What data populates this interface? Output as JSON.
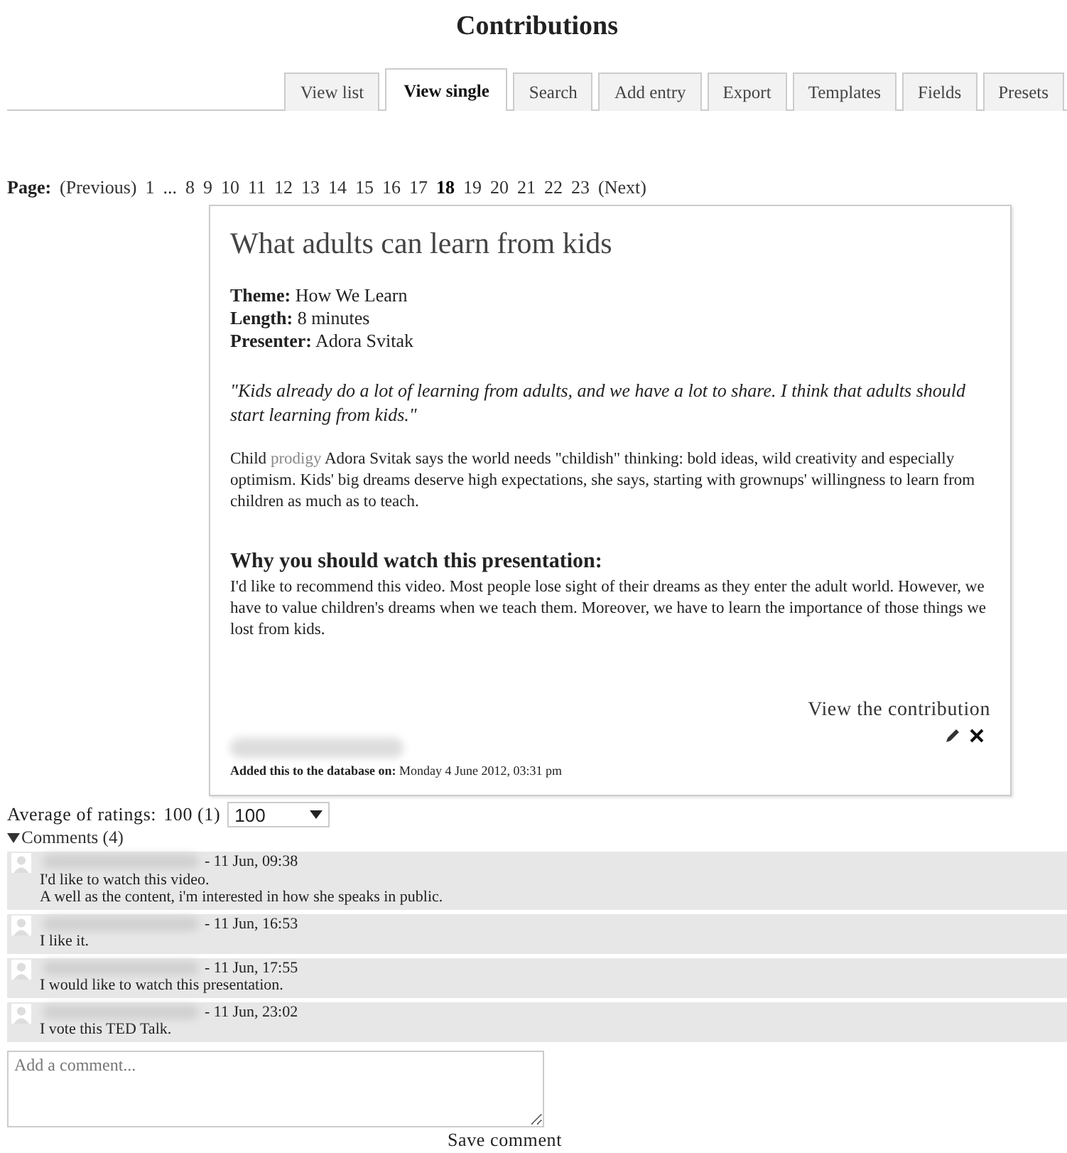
{
  "page_title": "Contributions",
  "tabs": [
    {
      "label": "View list",
      "selected": false
    },
    {
      "label": "View single",
      "selected": true
    },
    {
      "label": "Search",
      "selected": false
    },
    {
      "label": "Add entry",
      "selected": false
    },
    {
      "label": "Export",
      "selected": false
    },
    {
      "label": "Templates",
      "selected": false
    },
    {
      "label": "Fields",
      "selected": false
    },
    {
      "label": "Presets",
      "selected": false
    }
  ],
  "pager": {
    "label": "Page:",
    "previous": "(Previous)",
    "first": {
      "label": "1",
      "selected": false
    },
    "gap": "...",
    "pages": [
      {
        "label": "8",
        "selected": false
      },
      {
        "label": "9",
        "selected": false
      },
      {
        "label": "10",
        "selected": false
      },
      {
        "label": "11",
        "selected": false
      },
      {
        "label": "12",
        "selected": false
      },
      {
        "label": "13",
        "selected": false
      },
      {
        "label": "14",
        "selected": false
      },
      {
        "label": "15",
        "selected": false
      },
      {
        "label": "16",
        "selected": false
      },
      {
        "label": "17",
        "selected": false
      },
      {
        "label": "18",
        "selected": true
      },
      {
        "label": "19",
        "selected": false
      },
      {
        "label": "20",
        "selected": false
      },
      {
        "label": "21",
        "selected": false
      },
      {
        "label": "22",
        "selected": false
      },
      {
        "label": "23",
        "selected": false
      }
    ],
    "next": "(Next)"
  },
  "entry": {
    "title": "What adults can learn from kids",
    "fields": [
      {
        "label": "Theme:",
        "value": "How We Learn"
      },
      {
        "label": "Length:",
        "value": "8 minutes"
      },
      {
        "label": "Presenter:",
        "value": "Adora Svitak"
      }
    ],
    "quote": "\"Kids already do a lot of learning from adults, and we have a lot to share. I think that adults should start learning from kids.\"",
    "description": [
      {
        "kind": "text",
        "text": "Child "
      },
      {
        "kind": "link",
        "text": "prodigy"
      },
      {
        "kind": "text",
        "text": " Adora Svitak says the world needs \"childish\" thinking: bold ideas, wild creativity and especially optimism. Kids' big dreams deserve high expectations, she says, starting with grownups' willingness to learn from children as much as to teach."
      }
    ],
    "why_heading": "Why you should watch this presentation:",
    "why_text": "I'd like to recommend this video. Most people lose sight of their dreams as they enter the adult world. However, we have to value children's dreams when we teach them. Moreover, we have to learn the importance of those things we lost from kids.",
    "view_link": "View the contribution",
    "added_label": "Added this to the database on:",
    "added_date": "Monday 4 June 2012, 03:31 pm"
  },
  "rating": {
    "label": "Average of ratings:",
    "value": "100 (1)",
    "select": "100"
  },
  "comments": {
    "toggle": "Comments (4)",
    "expanded": true,
    "items": [
      {
        "time": "- 11 Jun, 09:38",
        "lines": [
          "I'd like to watch this video.",
          "A well as the content, i'm interested in how she speaks in public."
        ]
      },
      {
        "time": "- 11 Jun, 16:53",
        "lines": [
          "I like it."
        ]
      },
      {
        "time": "- 11 Jun, 17:55",
        "lines": [
          "I would like to watch this presentation."
        ]
      },
      {
        "time": "- 11 Jun, 23:02",
        "lines": [
          "I vote this TED Talk."
        ]
      }
    ],
    "placeholder": "Add a comment...",
    "save": "Save comment"
  }
}
